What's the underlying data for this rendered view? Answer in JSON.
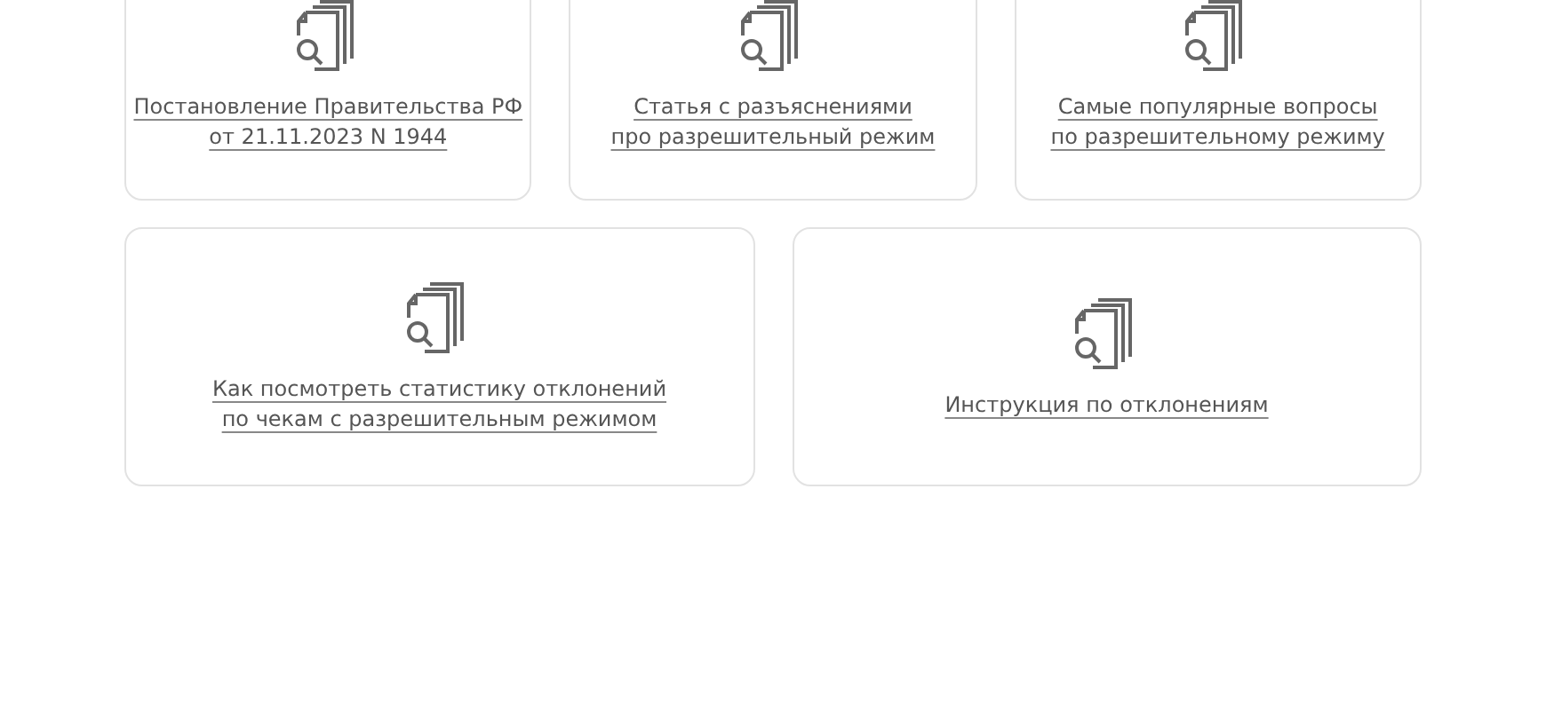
{
  "document_links": [
    {
      "text": "Постановление Правительства РФ\nот 21.11.2023 N 1944"
    },
    {
      "text": "Статья с разъяснениями\nпро разрешительный режим"
    },
    {
      "text": "Самые популярные вопросы\nпо разрешительному режиму"
    },
    {
      "text": "Как посмотреть статистику отклонений\nпо чекам с разрешительным режимом"
    },
    {
      "text": "Инструкция по отклонениям"
    }
  ]
}
